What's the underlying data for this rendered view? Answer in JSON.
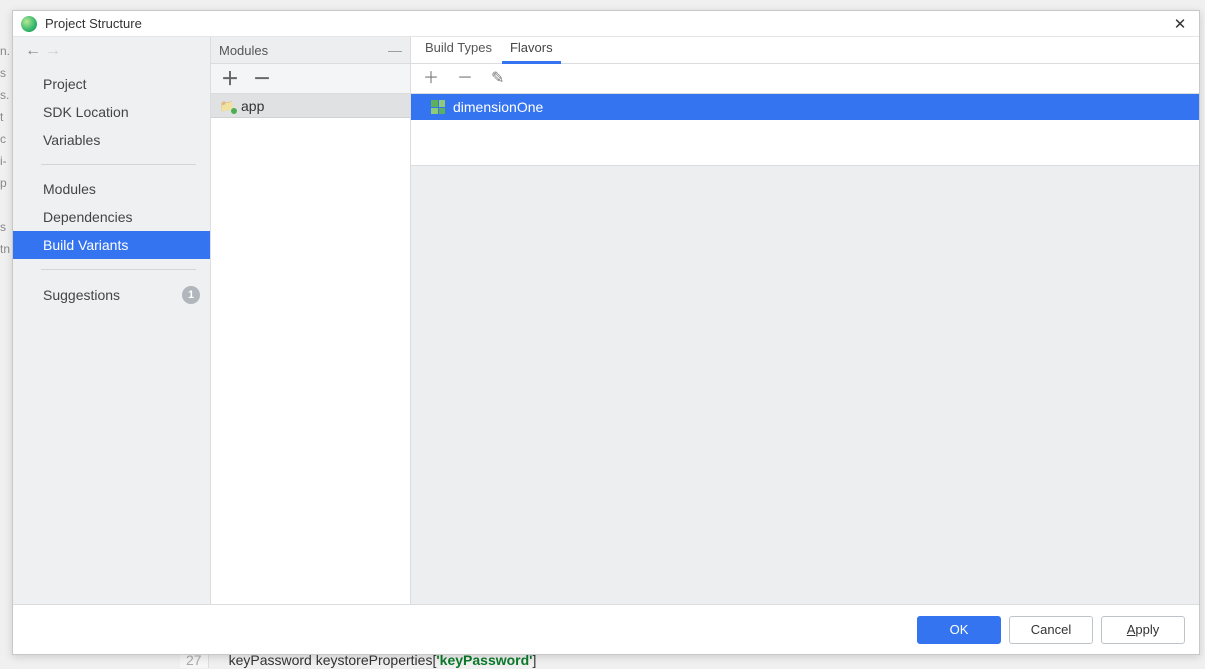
{
  "titlebar": {
    "title": "Project Structure"
  },
  "sidebar": {
    "items": [
      {
        "label": "Project"
      },
      {
        "label": "SDK Location"
      },
      {
        "label": "Variables"
      }
    ],
    "items2": [
      {
        "label": "Modules"
      },
      {
        "label": "Dependencies"
      },
      {
        "label": "Build Variants"
      }
    ],
    "items3": [
      {
        "label": "Suggestions",
        "badge": "1"
      }
    ]
  },
  "modules": {
    "header": "Modules",
    "entries": [
      {
        "label": "app"
      }
    ]
  },
  "main": {
    "tabs": [
      {
        "label": "Build Types",
        "active": false
      },
      {
        "label": "Flavors",
        "active": true
      }
    ],
    "flavors": [
      {
        "label": "dimensionOne"
      }
    ]
  },
  "footer": {
    "ok": "OK",
    "cancel": "Cancel",
    "apply_pre": "",
    "apply_u": "A",
    "apply_post": "pply"
  },
  "background": {
    "bottom_line_no": "27",
    "bottom_code_pre": "keyPassword keystoreProperties[",
    "bottom_code_str": "'keyPassword'",
    "bottom_code_post": "]"
  }
}
